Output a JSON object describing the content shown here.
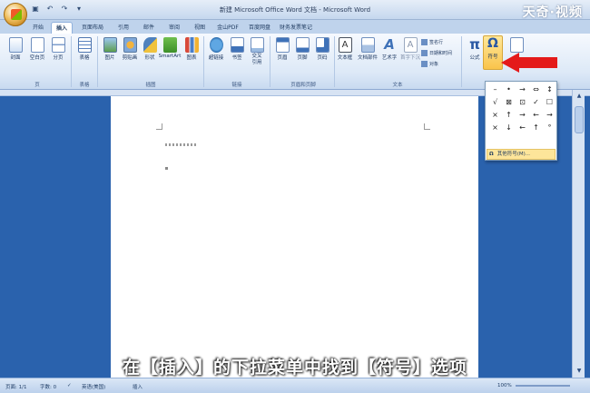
{
  "window": {
    "title": "新建 Microsoft Office Word 文档 - Microsoft Word",
    "watermark": "天奇·视频"
  },
  "tabs": [
    "开始",
    "插入",
    "页面布局",
    "引用",
    "邮件",
    "审阅",
    "视图",
    "金山PDF",
    "百度网盘",
    "财务发票笔记"
  ],
  "active_tab": "插入",
  "ribbon": {
    "buttons": {
      "cover": "封面",
      "blank_page": "空白页",
      "page_break": "分页",
      "table": "表格",
      "picture": "图片",
      "clipart": "剪贴画",
      "shapes": "形状",
      "smartart": "SmartArt",
      "chart": "图表",
      "hyperlink": "超链接",
      "bookmark": "书签",
      "cross_ref": "交叉引用",
      "header": "页眉",
      "footer": "页脚",
      "page_number": "页码",
      "textbox": "文本框",
      "quickparts": "文档部件",
      "wordart": "艺术字",
      "dropcap": "首字下沉",
      "equation": "公式",
      "symbol": "符号"
    },
    "small_items": [
      "签名行",
      "日期和时间",
      "对象"
    ],
    "groups": {
      "pages": "页",
      "tables": "表格",
      "illustrations": "插图",
      "links": "链接",
      "header_footer": "页眉和页脚",
      "text": "文本"
    }
  },
  "symbol_panel": {
    "symbols": [
      "–",
      "•",
      "→",
      "⇔",
      "↕",
      "√",
      "⊠",
      "⊡",
      "✓",
      "☐",
      "×",
      "↑",
      "→",
      "←",
      "→",
      "×",
      "↓",
      "←",
      "↑",
      "°"
    ],
    "more_label": "其他符号(M)..."
  },
  "subtitle": "在【插入】的下拉菜单中找到【符号】选项",
  "statusbar": {
    "page": "页面: 1/1",
    "words": "字数: 0",
    "language": "英语(美国)",
    "mode": "插入",
    "zoom": "100%"
  },
  "colors": {
    "app_background": "#2a62ad",
    "arrow": "#e41a1a",
    "highlight": "#fde59a"
  }
}
